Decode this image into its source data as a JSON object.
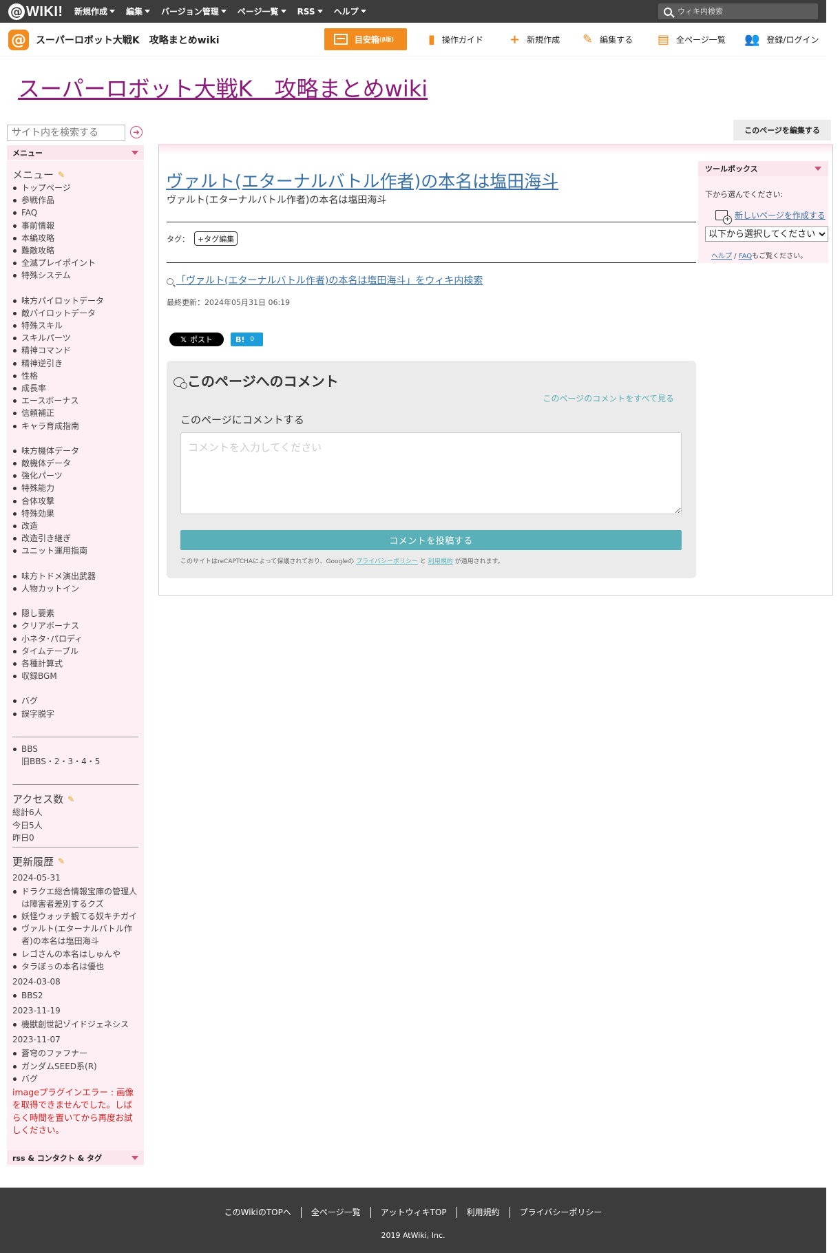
{
  "topbar": {
    "logo": "WIKI!",
    "menu": [
      "新規作成",
      "編集",
      "バージョン管理",
      "ページ一覧",
      "RSS",
      "ヘルプ"
    ],
    "search_placeholder": "ウィキ内検索"
  },
  "subbar": {
    "wiki_name": "スーパーロボット大戦K　攻略まとめwiki",
    "meyasu": "目安箱",
    "meyasu_small": "(β版)",
    "nav": [
      "操作ガイド",
      "新規作成",
      "編集する",
      "全ページ一覧",
      "登録/ログイン"
    ]
  },
  "wiki_title": "スーパーロボット大戦K　攻略まとめwiki",
  "sidebar": {
    "search_placeholder": "サイト内を検索する",
    "menu_bar": "メニュー",
    "menu_heading": "メニュー",
    "groups": [
      [
        "トップページ",
        "参戦作品",
        "FAQ",
        "事前情報",
        "本編攻略",
        "難敵攻略",
        "全滅プレイポイント",
        "特殊システム"
      ],
      [
        "味方パイロットデータ",
        "敵パイロットデータ",
        "特殊スキル",
        "スキルパーツ",
        "精神コマンド",
        "精神逆引き",
        "性格",
        "成長率",
        "エースボーナス",
        "信頼補正",
        "キャラ育成指南"
      ],
      [
        "味方機体データ",
        "敵機体データ",
        "強化パーツ",
        "特殊能力",
        "合体攻撃",
        "特殊効果",
        "改造",
        "改造引き継ぎ",
        "ユニット運用指南"
      ],
      [
        "味方トドメ演出武器",
        "人物カットイン"
      ],
      [
        "隠し要素",
        "クリアボーナス",
        "小ネタ･パロディ",
        "タイムテーブル",
        "各種計算式",
        "収録BGM"
      ],
      [
        "バグ",
        "誤字脱字"
      ]
    ],
    "bbs": "BBS",
    "old_bbs": "旧BBS・2・3・4・5",
    "access_heading": "アクセス数",
    "access": [
      "総計6人",
      "今日5人",
      "昨日0"
    ],
    "history_heading": "更新履歴",
    "history": [
      {
        "date": "2024-05-31",
        "items": [
          "ドラクエ総合情報宝庫の管理人は障害者差別するクズ",
          "妖怪ウォッチ観てる奴キチガイ",
          "ヴァルト(エターナルバトル作者)の本名は塩田海斗",
          "レゴさんの本名はしゅんや",
          "タラぼぅの本名は優也"
        ]
      },
      {
        "date": "2024-03-08",
        "items": [
          "BBS2"
        ]
      },
      {
        "date": "2023-11-19",
        "items": [
          "機獣創世記ゾイドジェネシス"
        ]
      },
      {
        "date": "2023-11-07",
        "items": [
          "蒼穹のファフナー",
          "ガンダムSEED系(R)",
          "バグ"
        ]
      }
    ],
    "image_error": "imageプラグインエラー : 画像を取得できませんでした。しばらく時間を置いてから再度お試しください。",
    "rss_bar": "rss & コンタクト & タグ"
  },
  "edit_page": "このページを編集する",
  "page": {
    "title": "ヴァルト(エターナルバトル作者)の本名は塩田海斗",
    "subtitle": "ヴァルト(エターナルバトル作者)の本名は塩田海斗",
    "tags_label": "タグ：",
    "tag_edit": "+タグ編集",
    "wiki_search_link": "「ヴァルト(エターナルバトル作者)の本名は塩田海斗」をウィキ内検索",
    "last_updated": "最終更新：2024年05月31日 06:19",
    "x_post": "ポスト",
    "hatena_label": "B!",
    "hatena_count": "0"
  },
  "comments": {
    "title": "このページへのコメント",
    "view_all": "このページのコメントをすべて見る",
    "label": "このページにコメントする",
    "placeholder": "コメントを入力してください",
    "submit": "コメントを投稿する",
    "recaptcha_pre": "このサイトはreCAPTCHAによって保護されており、Googleの",
    "privacy": "プライバシーポリシー",
    "and": "と",
    "terms": "利用規約",
    "recaptcha_post": "が適用されます。"
  },
  "toolbox": {
    "title": "ツールボックス",
    "pick": "下から選んでください:",
    "new_page": "新しいページを作成する",
    "select": "以下から選択してください",
    "help": "ヘルプ",
    "faq": "FAQ",
    "help_tail": "もご覧ください。"
  },
  "footer": {
    "links": [
      "このWikiのTOPへ",
      "全ページ一覧",
      "アットウィキTOP",
      "利用規約",
      "プライバシーポリシー"
    ],
    "copyright": "2019 AtWiki, Inc."
  }
}
